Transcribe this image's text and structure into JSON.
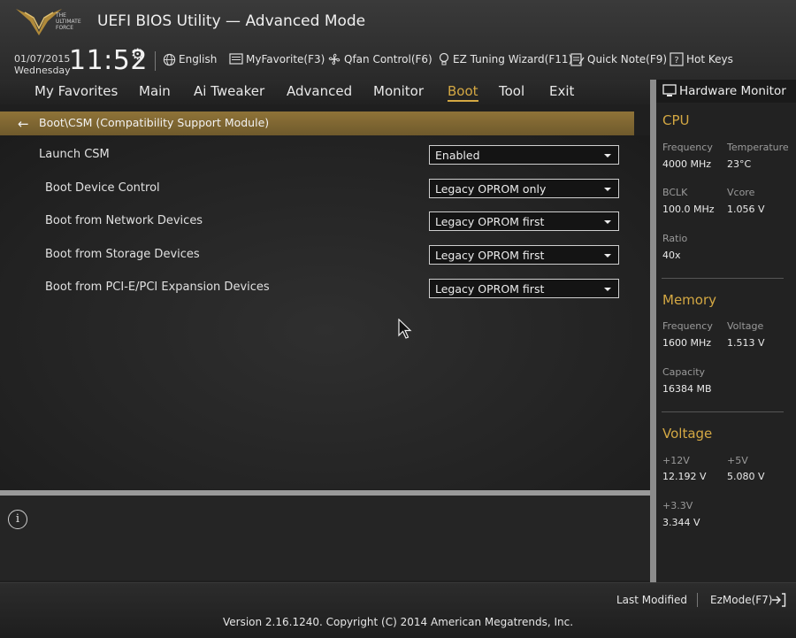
{
  "header": {
    "logo_text": "THE ULTIMATE FORCE",
    "title": "UEFI BIOS Utility — Advanced Mode",
    "date": "01/07/2015",
    "weekday": "Wednesday",
    "time": "11:52",
    "toolbar": [
      {
        "label": "English",
        "icon": "globe-icon"
      },
      {
        "label": "MyFavorite(F3)",
        "icon": "favorite-page-icon"
      },
      {
        "label": "Qfan Control(F6)",
        "icon": "fan-icon"
      },
      {
        "label": "EZ Tuning Wizard(F11)",
        "icon": "lightbulb-icon"
      },
      {
        "label": "Quick Note(F9)",
        "icon": "note-icon"
      },
      {
        "label": "Hot Keys",
        "icon": "question-box-icon"
      }
    ]
  },
  "menu": {
    "tabs": [
      "My Favorites",
      "Main",
      "Ai Tweaker",
      "Advanced",
      "Monitor",
      "Boot",
      "Tool",
      "Exit"
    ],
    "active": "Boot"
  },
  "breadcrumb": "Boot\\CSM (Compatibility Support Module)",
  "options": [
    {
      "label": "Launch CSM",
      "value": "Enabled"
    },
    {
      "label": "Boot Device Control",
      "value": "Legacy OPROM only"
    },
    {
      "label": "Boot from Network Devices",
      "value": "Legacy OPROM first"
    },
    {
      "label": "Boot from Storage Devices",
      "value": "Legacy OPROM first"
    },
    {
      "label": "Boot from PCI-E/PCI Expansion Devices",
      "value": "Legacy OPROM first"
    }
  ],
  "hardware_monitor": {
    "title": "Hardware Monitor",
    "cpu": {
      "heading": "CPU",
      "frequency_label": "Frequency",
      "frequency": "4000 MHz",
      "temperature_label": "Temperature",
      "temperature": "23°C",
      "bclk_label": "BCLK",
      "bclk": "100.0 MHz",
      "vcore_label": "Vcore",
      "vcore": "1.056 V",
      "ratio_label": "Ratio",
      "ratio": "40x"
    },
    "memory": {
      "heading": "Memory",
      "frequency_label": "Frequency",
      "frequency": "1600 MHz",
      "voltage_label": "Voltage",
      "voltage": "1.513 V",
      "capacity_label": "Capacity",
      "capacity": "16384 MB"
    },
    "voltage": {
      "heading": "Voltage",
      "v12_label": "+12V",
      "v12": "12.192 V",
      "v5_label": "+5V",
      "v5": "5.080 V",
      "v33_label": "+3.3V",
      "v33": "3.344 V"
    }
  },
  "footer": {
    "last_modified": "Last Modified",
    "ezmode": "EzMode(F7)",
    "version": "Version 2.16.1240. Copyright (C) 2014 American Megatrends, Inc."
  },
  "colors": {
    "accent": "#d4a843",
    "breadcrumb_bg": "#8f7338"
  }
}
